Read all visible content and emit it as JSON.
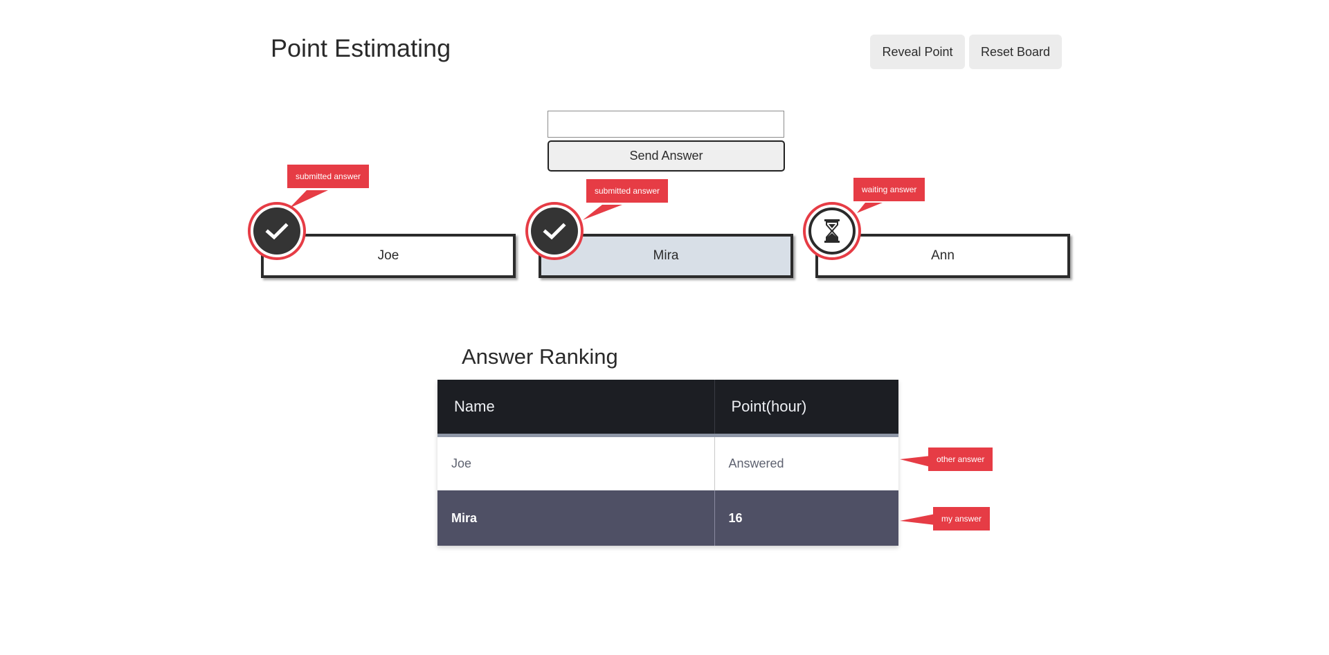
{
  "header": {
    "title": "Point Estimating",
    "reveal_label": "Reveal Point",
    "reset_label": "Reset Board"
  },
  "answer_form": {
    "input_value": "",
    "input_placeholder": "",
    "send_label": "Send Answer"
  },
  "players": [
    {
      "name": "Joe",
      "status": "submitted",
      "status_icon": "check-icon",
      "callout": "submitted answer",
      "is_me": false
    },
    {
      "name": "Mira",
      "status": "submitted",
      "status_icon": "check-icon",
      "callout": "submitted answer",
      "is_me": true
    },
    {
      "name": "Ann",
      "status": "waiting",
      "status_icon": "hourglass-icon",
      "callout": "waiting answer",
      "is_me": false
    }
  ],
  "ranking": {
    "title": "Answer Ranking",
    "columns": [
      "Name",
      "Point(hour)"
    ],
    "rows": [
      {
        "name": "Joe",
        "value": "Answered",
        "callout": "other answer"
      },
      {
        "name": "Mira",
        "value": "16",
        "callout": "my answer"
      }
    ]
  },
  "colors": {
    "accent_red": "#e63c45",
    "table_header": "#1c1e23",
    "my_row": "#4f5065",
    "my_card": "#d8dfe7"
  }
}
